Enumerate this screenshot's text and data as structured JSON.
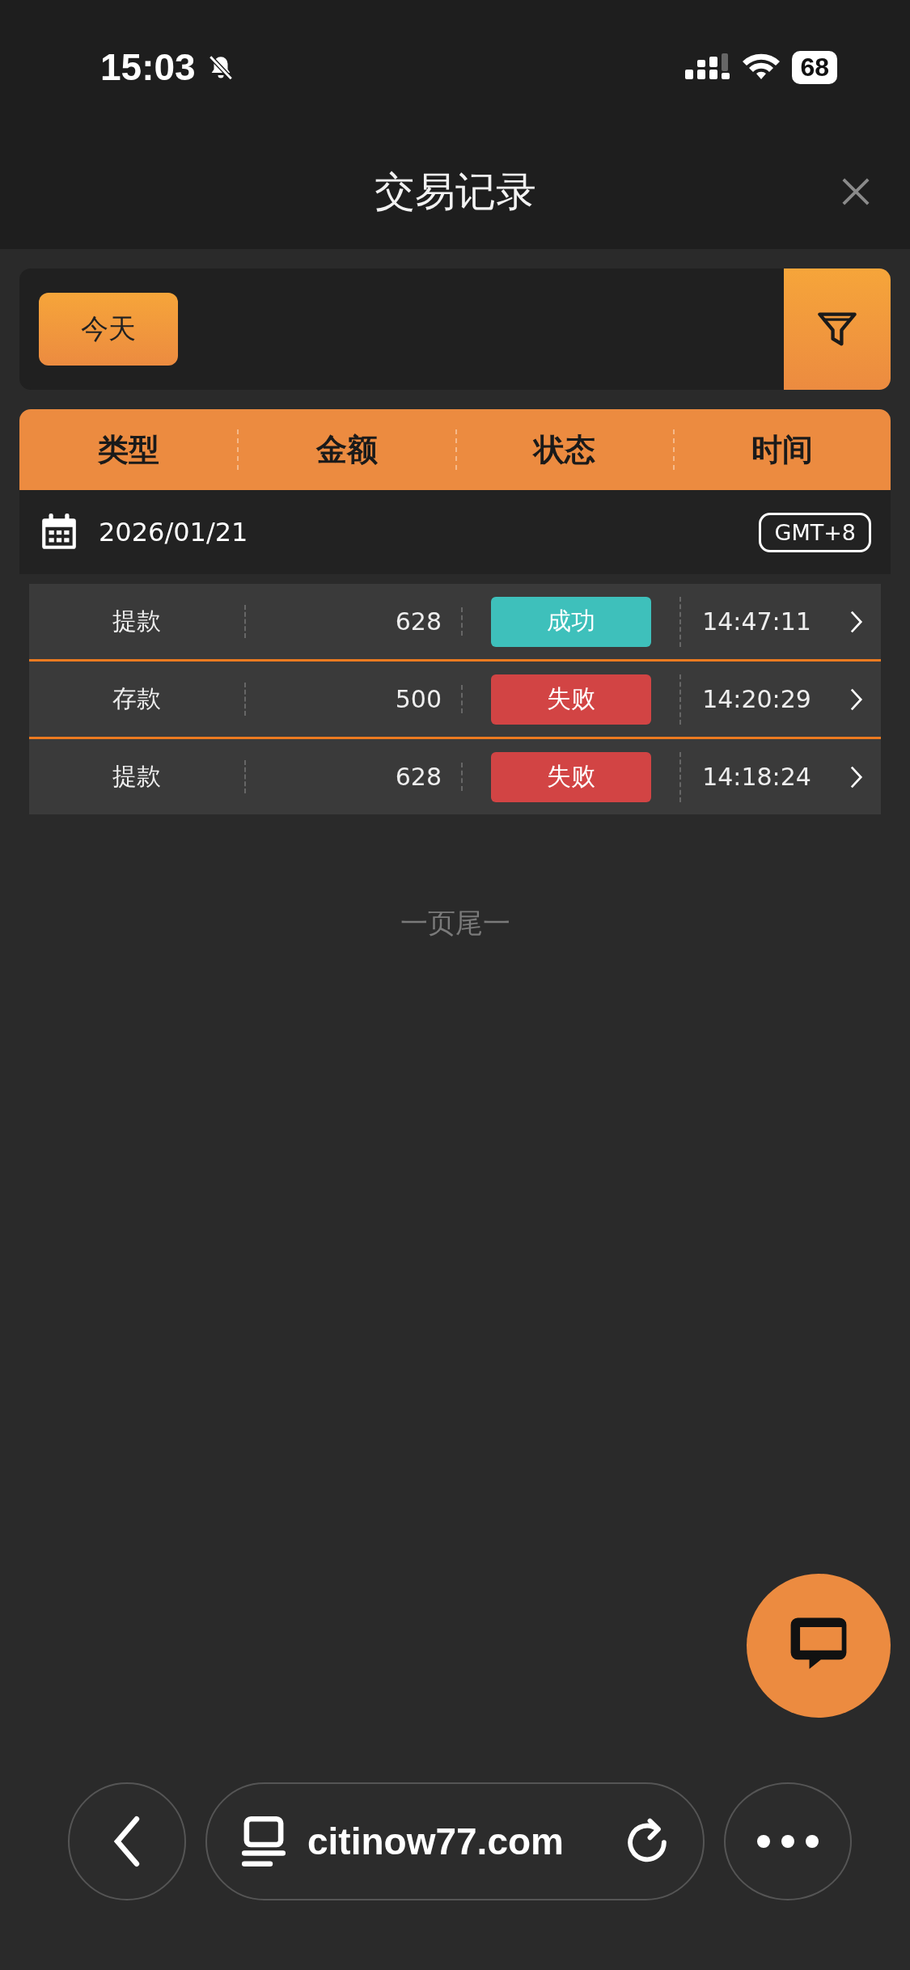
{
  "status_bar": {
    "time": "15:03",
    "battery": "68"
  },
  "header": {
    "title": "交易记录"
  },
  "filter": {
    "date_button": "今天"
  },
  "table": {
    "columns": [
      "类型",
      "金额",
      "状态",
      "时间"
    ],
    "date": "2026/01/21",
    "timezone": "GMT+8",
    "rows": [
      {
        "type": "提款",
        "amount": "628",
        "status": {
          "label": "成功",
          "kind": "success"
        },
        "time": "14:47:11"
      },
      {
        "type": "存款",
        "amount": "500",
        "status": {
          "label": "失败",
          "kind": "failed"
        },
        "time": "14:20:29"
      },
      {
        "type": "提款",
        "amount": "628",
        "status": {
          "label": "失败",
          "kind": "failed"
        },
        "time": "14:18:24"
      }
    ]
  },
  "footer": "一页尾一",
  "browser": {
    "url": "citinow77.com"
  }
}
